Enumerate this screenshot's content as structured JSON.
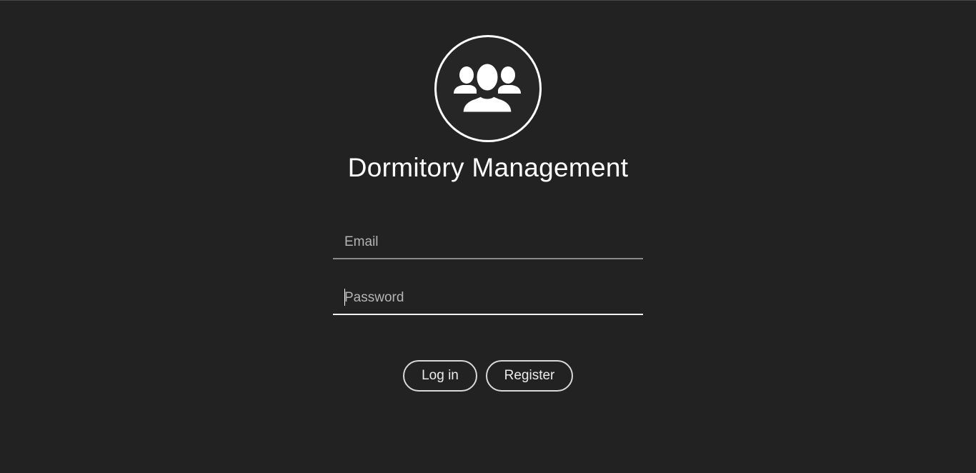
{
  "app": {
    "title": "Dormitory Management",
    "logo_icon": "users-group-icon"
  },
  "form": {
    "email": {
      "placeholder": "Email",
      "value": ""
    },
    "password": {
      "placeholder": "Password",
      "value": ""
    }
  },
  "actions": {
    "login_label": "Log in",
    "register_label": "Register"
  },
  "colors": {
    "background": "#222222",
    "foreground": "#ffffff",
    "muted": "#b4b4b4"
  }
}
